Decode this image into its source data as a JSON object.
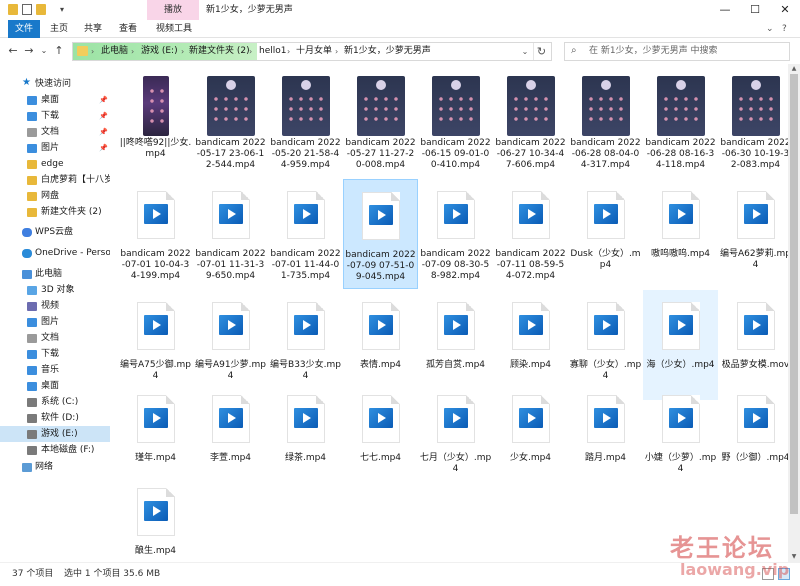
{
  "title_bar": {
    "context_tab": "播放",
    "title": "新1少女，少萝无男声",
    "minimize_icon": "minimize-icon",
    "maximize_icon": "maximize-icon",
    "close_icon": "close-icon"
  },
  "ribbon": {
    "tabs": [
      "文件",
      "主页",
      "共享",
      "查看",
      "视频工具"
    ],
    "expand_icon": "chevron-down-icon",
    "help_icon": "help-icon"
  },
  "address_bar": {
    "crumbs": [
      "此电脑",
      "游戏 (E:)",
      "新建文件夹 (2)",
      "hello1",
      "十月女单",
      "新1少女，少萝无男声"
    ],
    "search_placeholder": "在 新1少女，少萝无男声 中搜索"
  },
  "nav_pane": {
    "quick_access": "快速访问",
    "quick_items": [
      "桌面",
      "下载",
      "文档",
      "图片",
      "edge",
      "白虎萝莉【十八岁小",
      "网盘",
      "新建文件夹 (2)"
    ],
    "wps": "WPS云盘",
    "onedrive": "OneDrive - Persona",
    "this_pc": "此电脑",
    "pc_items": [
      "3D 对象",
      "视频",
      "图片",
      "文档",
      "下载",
      "音乐",
      "桌面",
      "系统 (C:)",
      "软件 (D:)",
      "游戏 (E:)",
      "本地磁盘 (F:)"
    ],
    "network": "网络"
  },
  "files": [
    {
      "name": "||咚咚嗒92||少女.mp4",
      "thumb": "phone"
    },
    {
      "name": "bandicam 2022-05-17 23-06-12-544.mp4",
      "thumb": "screen"
    },
    {
      "name": "bandicam 2022-05-20 21-58-44-959.mp4",
      "thumb": "screen"
    },
    {
      "name": "bandicam 2022-05-27 11-27-20-008.mp4",
      "thumb": "screen"
    },
    {
      "name": "bandicam 2022-06-15 09-01-00-410.mp4",
      "thumb": "screen"
    },
    {
      "name": "bandicam 2022-06-27 10-34-47-606.mp4",
      "thumb": "screen"
    },
    {
      "name": "bandicam 2022-06-28 08-04-04-317.mp4",
      "thumb": "screen"
    },
    {
      "name": "bandicam 2022-06-28 08-16-34-118.mp4",
      "thumb": "screen"
    },
    {
      "name": "bandicam 2022-06-30 10-19-32-083.mp4",
      "thumb": "screen"
    },
    {
      "name": "bandicam 2022-07-01 10-04-34-199.mp4",
      "thumb": "video"
    },
    {
      "name": "bandicam 2022-07-01 11-31-39-650.mp4",
      "thumb": "video"
    },
    {
      "name": "bandicam 2022-07-01 11-44-01-735.mp4",
      "thumb": "video"
    },
    {
      "name": "bandicam 2022-07-09 07-51-09-045.mp4",
      "thumb": "video"
    },
    {
      "name": "bandicam 2022-07-09 08-30-58-982.mp4",
      "thumb": "video"
    },
    {
      "name": "bandicam 2022-07-11 08-59-54-072.mp4",
      "thumb": "video"
    },
    {
      "name": "Dusk（少女）.mp4",
      "thumb": "video"
    },
    {
      "name": "嗷呜嗷呜.mp4",
      "thumb": "video"
    },
    {
      "name": "编号A62萝莉.mp4",
      "thumb": "video"
    },
    {
      "name": "编号A75少御.mp4",
      "thumb": "video"
    },
    {
      "name": "编号A91少萝.mp4",
      "thumb": "video"
    },
    {
      "name": "编号B33少女.mp4",
      "thumb": "video"
    },
    {
      "name": "表情.mp4",
      "thumb": "video"
    },
    {
      "name": "孤芳自赏.mp4",
      "thumb": "video"
    },
    {
      "name": "顾染.mp4",
      "thumb": "video"
    },
    {
      "name": "寡聊（少女）.mp4",
      "thumb": "video"
    },
    {
      "name": "海（少女）.mp4",
      "thumb": "video"
    },
    {
      "name": "极品萝女模.mov",
      "thumb": "video"
    },
    {
      "name": "瑾年.mp4",
      "thumb": "video"
    },
    {
      "name": "李萱.mp4",
      "thumb": "video"
    },
    {
      "name": "绿茶.mp4",
      "thumb": "video"
    },
    {
      "name": "七七.mp4",
      "thumb": "video"
    },
    {
      "name": "七月（少女）.mp4",
      "thumb": "video"
    },
    {
      "name": "少女.mp4",
      "thumb": "video"
    },
    {
      "name": "踏月.mp4",
      "thumb": "video"
    },
    {
      "name": "小婕（少萝）.mp4",
      "thumb": "video"
    },
    {
      "name": "野（少御）.mp4",
      "thumb": "video"
    },
    {
      "name": "酿生.mp4",
      "thumb": "video"
    }
  ],
  "selected_index": 12,
  "hover_index": 25,
  "status": {
    "count": "37 个项目",
    "selected": "选中 1 个项目  35.6 MB"
  },
  "watermark": {
    "line1": "老王论坛",
    "line2": "laowang.vip"
  },
  "colors": {
    "accent": "#1979ca",
    "context_tab": "#f9d5e8",
    "address_highlight": "#9be3a4",
    "selection": "#cce8ff"
  }
}
